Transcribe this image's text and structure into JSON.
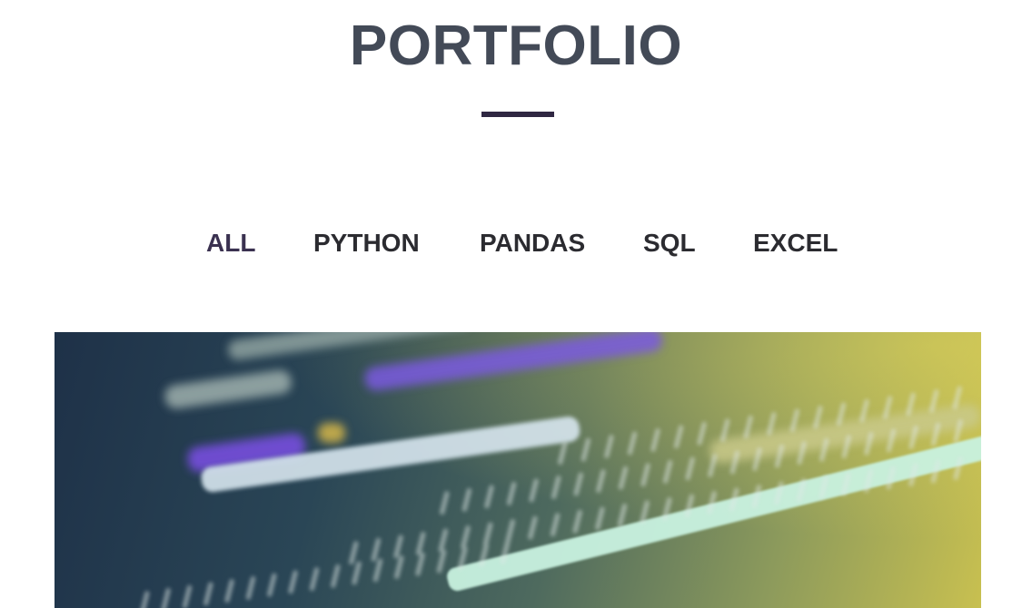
{
  "section": {
    "title": "PORTFOLIO"
  },
  "filters": [
    {
      "label": "ALL",
      "active": true
    },
    {
      "label": "PYTHON",
      "active": false
    },
    {
      "label": "PANDAS",
      "active": false
    },
    {
      "label": "SQL",
      "active": false
    },
    {
      "label": "EXCEL",
      "active": false
    }
  ],
  "colors": {
    "title": "#434a57",
    "divider": "#2f2742",
    "filter_text": "#2b2b30",
    "filter_active": "#3a3150"
  },
  "hero_image": {
    "icon": "code-screenshot-image"
  }
}
